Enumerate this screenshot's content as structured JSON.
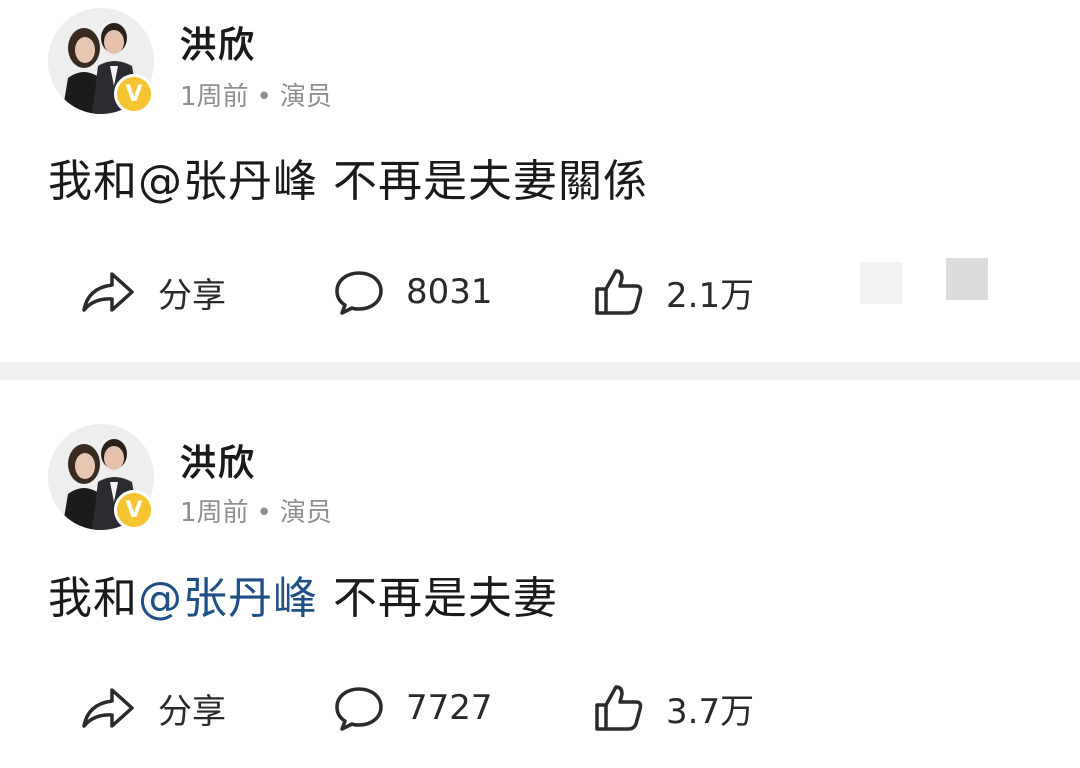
{
  "posts": [
    {
      "author": "洪欣",
      "time": "1周前",
      "separator": "•",
      "tag": "演员",
      "verified_badge": "V",
      "content_prefix": "我和",
      "mention": "@张丹峰",
      "content_suffix": " 不再是夫妻關係",
      "share_label": "分享",
      "comments": "8031",
      "likes": "2.1万"
    },
    {
      "author": "洪欣",
      "time": "1周前",
      "separator": "•",
      "tag": "演员",
      "verified_badge": "V",
      "content_prefix": "我和",
      "mention": "@张丹峰",
      "content_suffix": " 不再是夫妻",
      "share_label": "分享",
      "comments": "7727",
      "likes": "3.7万"
    }
  ],
  "colors": {
    "mention_link": "#1f4f87",
    "badge": "#f4c430",
    "meta_text": "#8f8f8f",
    "separator_band": "#f1f1f1"
  },
  "icons": [
    "share-icon",
    "comment-icon",
    "like-icon",
    "verified-badge-icon"
  ]
}
